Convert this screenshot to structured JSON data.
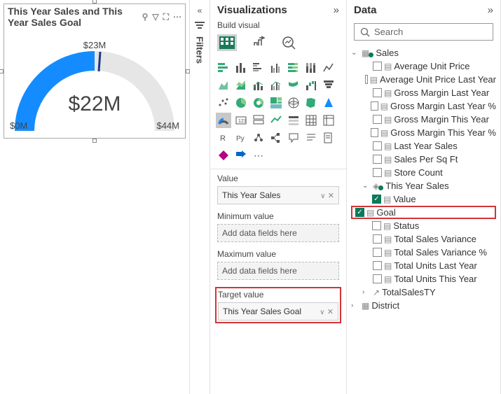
{
  "tile": {
    "title": "This Year Sales and This Year Sales Goal",
    "header_icons": [
      "anchor-icon",
      "filter-icon",
      "comment-icon",
      "focus-icon",
      "more-icon"
    ]
  },
  "chart_data": {
    "type": "gauge",
    "value_label": "$22M",
    "target_label": "$23M",
    "min_label": "$0M",
    "max_label": "$44M",
    "value": 22,
    "target": 23,
    "min": 0,
    "max": 44
  },
  "filters_label": "Filters",
  "viz": {
    "title": "Visualizations",
    "build_label": "Build visual",
    "wells": {
      "value": {
        "label": "Value",
        "item": "This Year Sales"
      },
      "min": {
        "label": "Minimum value",
        "placeholder": "Add data fields here"
      },
      "max": {
        "label": "Maximum value",
        "placeholder": "Add data fields here"
      },
      "target": {
        "label": "Target value",
        "item": "This Year Sales Goal"
      }
    }
  },
  "data": {
    "title": "Data",
    "search_placeholder": "Search",
    "tables": [
      {
        "name": "Sales",
        "expanded": true,
        "fields": [
          {
            "label": "Average Unit Price",
            "checked": false,
            "icon": "measure"
          },
          {
            "label": "Average Unit Price Last Year",
            "checked": false,
            "icon": "measure"
          },
          {
            "label": "Gross Margin Last Year",
            "checked": false,
            "icon": "measure"
          },
          {
            "label": "Gross Margin Last Year %",
            "checked": false,
            "icon": "measure"
          },
          {
            "label": "Gross Margin This Year",
            "checked": false,
            "icon": "measure"
          },
          {
            "label": "Gross Margin This Year %",
            "checked": false,
            "icon": "measure"
          },
          {
            "label": "Last Year Sales",
            "checked": false,
            "icon": "measure"
          },
          {
            "label": "Sales Per Sq Ft",
            "checked": false,
            "icon": "measure"
          },
          {
            "label": "Store Count",
            "checked": false,
            "icon": "measure"
          }
        ],
        "kpi": {
          "label": "This Year Sales",
          "expanded": true,
          "children": [
            {
              "label": "Value",
              "checked": true
            },
            {
              "label": "Goal",
              "checked": true,
              "highlight": true
            },
            {
              "label": "Status",
              "checked": false
            }
          ]
        },
        "fields2": [
          {
            "label": "Total Sales Variance",
            "checked": false,
            "icon": "measure"
          },
          {
            "label": "Total Sales Variance %",
            "checked": false,
            "icon": "measure"
          },
          {
            "label": "Total Units Last Year",
            "checked": false,
            "icon": "measure"
          },
          {
            "label": "Total Units This Year",
            "checked": false,
            "icon": "measure"
          },
          {
            "label": "TotalSalesTY",
            "checked": null,
            "icon": "trend",
            "expandable": true
          }
        ]
      },
      {
        "name": "District",
        "expanded": false
      }
    ]
  }
}
